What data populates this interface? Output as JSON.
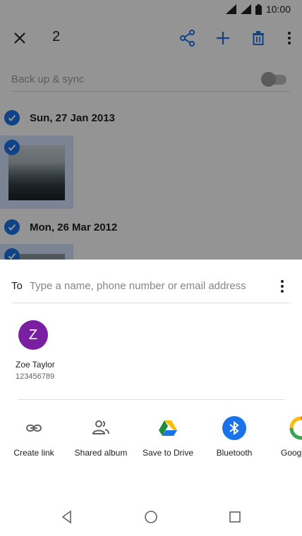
{
  "status_bar": {
    "time": "10:00"
  },
  "app_bar": {
    "selected_count": "2"
  },
  "sync": {
    "label": "Back up & sync"
  },
  "groups": [
    {
      "date": "Sun, 27 Jan 2013"
    },
    {
      "date": "Mon, 26 Mar 2012"
    }
  ],
  "share_sheet": {
    "to_label": "To",
    "to_placeholder": "Type a name, phone number or email address",
    "contact": {
      "initial": "Z",
      "name": "Zoe Taylor",
      "phone": "123456789"
    },
    "apps": [
      {
        "label": "Create link",
        "icon": "link-icon"
      },
      {
        "label": "Shared album",
        "icon": "people-icon"
      },
      {
        "label": "Save to Drive",
        "icon": "google-drive-icon"
      },
      {
        "label": "Bluetooth",
        "icon": "bluetooth-icon"
      },
      {
        "label": "Goog",
        "icon": "google-icon"
      }
    ]
  },
  "colors": {
    "accent": "#1a73e8",
    "avatar": "#7b1fa2",
    "scrim": "rgba(0,0,0,0.42)"
  }
}
